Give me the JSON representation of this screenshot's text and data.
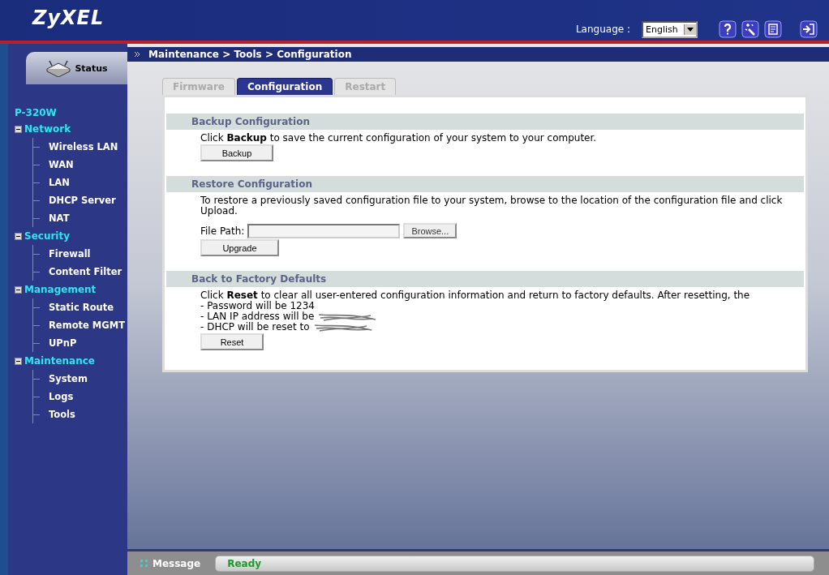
{
  "header": {
    "logo": "ZyXEL",
    "language_label": "Language :",
    "language": "English"
  },
  "sidebar": {
    "status_tab": "Status",
    "device": "P-320W",
    "groups": [
      {
        "label": "Network",
        "expanded": true,
        "children": [
          {
            "label": "Wireless LAN"
          },
          {
            "label": "WAN"
          },
          {
            "label": "LAN"
          },
          {
            "label": "DHCP Server"
          },
          {
            "label": "NAT"
          }
        ]
      },
      {
        "label": "Security",
        "expanded": true,
        "children": [
          {
            "label": "Firewall"
          },
          {
            "label": "Content Filter"
          }
        ]
      },
      {
        "label": "Management",
        "expanded": true,
        "children": [
          {
            "label": "Static Route"
          },
          {
            "label": "Remote MGMT"
          },
          {
            "label": "UPnP"
          }
        ]
      },
      {
        "label": "Maintenance",
        "expanded": true,
        "children": [
          {
            "label": "System"
          },
          {
            "label": "Logs"
          },
          {
            "label": "Tools"
          }
        ]
      }
    ]
  },
  "breadcrumb": "Maintenance > Tools > Configuration",
  "tabs": [
    {
      "label": "Firmware",
      "selected": false
    },
    {
      "label": "Configuration",
      "selected": true
    },
    {
      "label": "Restart",
      "selected": false
    }
  ],
  "sections": [
    {
      "kind": "backup",
      "title": "Backup Configuration",
      "text": "Click **Backup** to save the current configuration of your system to your computer.",
      "button": "Backup"
    },
    {
      "kind": "restore",
      "title": "Restore Configuration",
      "text": "To restore a previously saved configuration file to your system, browse to the location of the configuration file and click Upload.",
      "field_label": "File Path:",
      "browse": "Browse...",
      "button": "Upgrade"
    },
    {
      "kind": "reset",
      "title": "Back to Factory Defaults",
      "text": "Click **Reset** to clear all user-entered configuration information and return to factory defaults. After resetting, the",
      "lines": [
        {
          "text": "- Password will be 1234",
          "redacted": false
        },
        {
          "text": "- LAN IP address will be",
          "redacted": true
        },
        {
          "text": "- DHCP will be reset to",
          "redacted": true
        }
      ],
      "button": "Reset"
    }
  ],
  "status_bar": {
    "label": "Message",
    "value": "Ready"
  }
}
